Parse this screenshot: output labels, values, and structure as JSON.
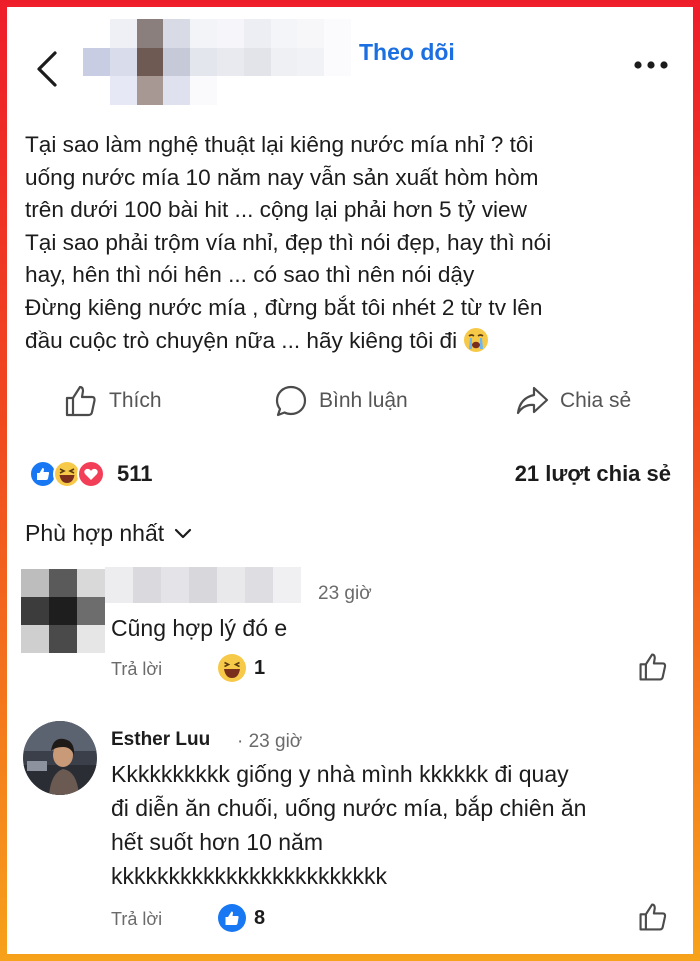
{
  "header": {
    "follow_label": "Theo dõi"
  },
  "post": {
    "lines": [
      "Tại sao làm nghệ thuật lại kiêng nước mía nhỉ ? tôi",
      "uống nước mía 10 năm nay vẫn sản xuất hòm hòm",
      "trên dưới 100 bài hit ... cộng lại phải hơn 5 tỷ view",
      "Tại sao phải trộm vía nhỉ, đẹp thì nói đẹp, hay thì nói",
      "hay, hên thì nói hên ... có sao thì nên nói dậy",
      "Đừng kiêng nước mía , đừng bắt tôi nhét 2 từ tv lên",
      "đầu cuộc trò chuyện nữa ... hãy kiêng tôi đi"
    ],
    "last_emoji": "crying-face"
  },
  "actions": {
    "like_label": "Thích",
    "comment_label": "Bình luận",
    "share_label": "Chia sẻ"
  },
  "stats": {
    "reaction_count": "511",
    "shares_label": "21 lượt chia sẻ",
    "reaction_types": [
      "like",
      "haha",
      "love"
    ]
  },
  "sort": {
    "label": "Phù hợp nhất"
  },
  "comments": [
    {
      "name": "",
      "time": "23 giờ",
      "text_lines": [
        "Cũng hợp lý đó e"
      ],
      "reply_label": "Trả lời",
      "reaction_type": "haha",
      "reaction_count": "1"
    },
    {
      "name": "Esther Luu",
      "time": "· 23 giờ",
      "text_lines": [
        "Kkkkkkkkkk giống y nhà mình kkkkkk đi quay",
        "đi diễn ăn chuối, uống nước mía, bắp chiên ăn",
        "hết suốt hơn 10 năm",
        "kkkkkkkkkkkkkkkkkkkkkkkk"
      ],
      "reply_label": "Trả lời",
      "reaction_type": "like",
      "reaction_count": "8"
    }
  ],
  "colors": {
    "accent": "#1b6fe0",
    "like_blue": "#1877f2",
    "love_red": "#f33e58",
    "haha_yellow": "#f7c948",
    "border_top": "#ee1d2a",
    "border_bottom": "#f7a21b"
  }
}
